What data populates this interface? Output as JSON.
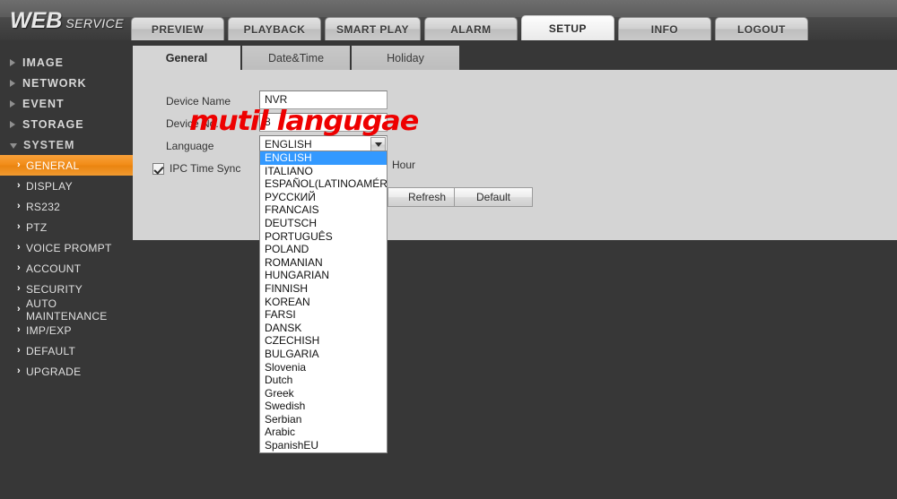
{
  "header": {
    "logo_main": "WEB",
    "logo_sub": "SERVICE",
    "nav_tabs": [
      {
        "label": "PREVIEW",
        "active": false
      },
      {
        "label": "PLAYBACK",
        "active": false
      },
      {
        "label": "SMART PLAY",
        "active": false
      },
      {
        "label": "ALARM",
        "active": false
      },
      {
        "label": "SETUP",
        "active": true
      },
      {
        "label": "INFO",
        "active": false
      },
      {
        "label": "LOGOUT",
        "active": false
      }
    ]
  },
  "sidebar": {
    "groups": [
      {
        "label": "IMAGE",
        "expanded": false
      },
      {
        "label": "NETWORK",
        "expanded": false
      },
      {
        "label": "EVENT",
        "expanded": false
      },
      {
        "label": "STORAGE",
        "expanded": false
      },
      {
        "label": "SYSTEM",
        "expanded": true
      }
    ],
    "system_items": [
      {
        "label": "GENERAL",
        "selected": true
      },
      {
        "label": "DISPLAY",
        "selected": false
      },
      {
        "label": "RS232",
        "selected": false
      },
      {
        "label": "PTZ",
        "selected": false
      },
      {
        "label": "VOICE PROMPT",
        "selected": false
      },
      {
        "label": "ACCOUNT",
        "selected": false
      },
      {
        "label": "SECURITY",
        "selected": false
      },
      {
        "label": "AUTO MAINTENANCE",
        "selected": false
      },
      {
        "label": "IMP/EXP",
        "selected": false
      },
      {
        "label": "DEFAULT",
        "selected": false
      },
      {
        "label": "UPGRADE",
        "selected": false
      }
    ]
  },
  "content": {
    "tabs": [
      {
        "label": "General",
        "active": true
      },
      {
        "label": "Date&Time",
        "active": false
      },
      {
        "label": "Holiday",
        "active": false
      }
    ],
    "form": {
      "device_name_label": "Device Name",
      "device_name_value": "NVR",
      "device_no_label": "Device No.",
      "device_no_value": "8",
      "language_label": "Language",
      "language_value": "ENGLISH",
      "ipc_time_sync_label": "IPC Time Sync",
      "ipc_time_sync_checked": true,
      "hour_label": "Hour"
    },
    "buttons": {
      "refresh": "Refresh",
      "default": "Default"
    },
    "language_options": [
      "ENGLISH",
      "ITALIANO",
      "ESPAÑOL(LATINOAMÉRICA)",
      "РУССКИЙ",
      "FRANCAIS",
      "DEUTSCH",
      "PORTUGUÊS",
      "POLAND",
      "ROMANIAN",
      "HUNGARIAN",
      "FINNISH",
      "KOREAN",
      "FARSI",
      "DANSK",
      "CZECHISH",
      "BULGARIA",
      "Slovenia",
      "Dutch",
      "Greek",
      "Swedish",
      "Serbian",
      "Arabic",
      "SpanishEU"
    ],
    "language_selected_index": 0
  },
  "overlay": {
    "watermark_text": "mutil langugae",
    "watermark_color": "#ee0000"
  },
  "colors": {
    "accent_orange": "#f28c17",
    "select_highlight": "#3399ff",
    "panel_bg": "#d4d4d4",
    "app_bg": "#373737"
  }
}
